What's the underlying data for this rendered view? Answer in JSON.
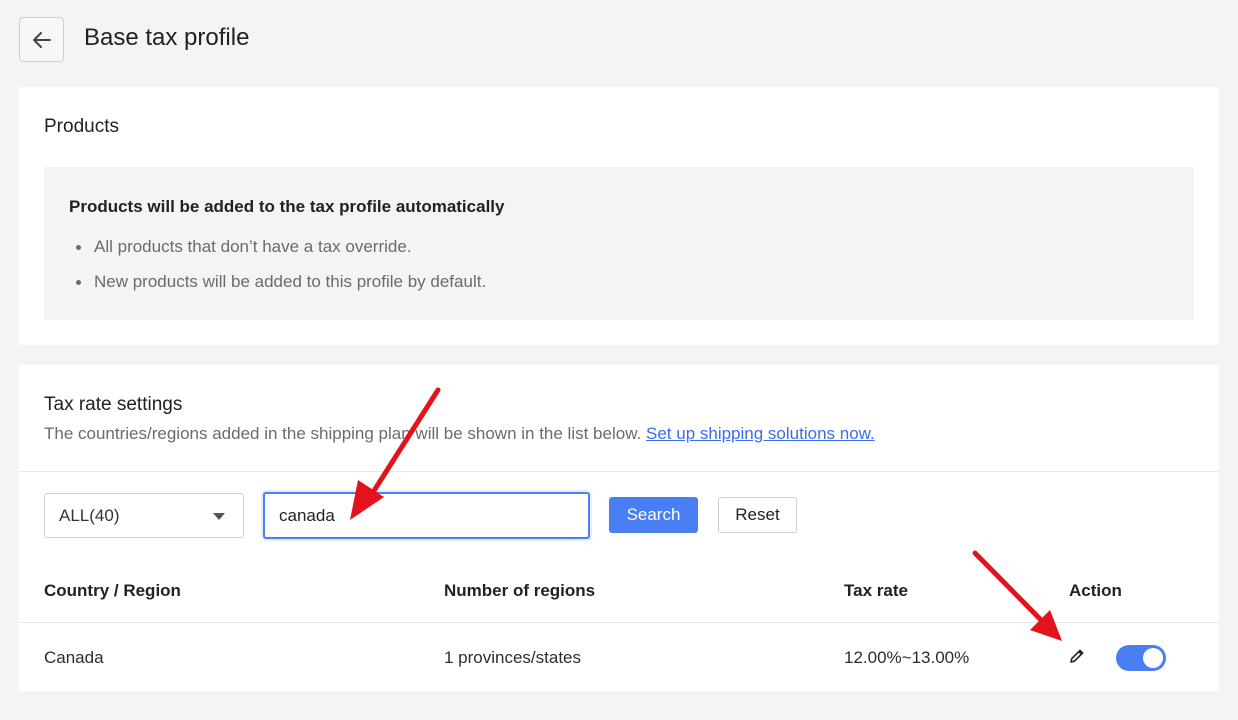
{
  "header": {
    "back_icon": "arrow-left-icon",
    "title": "Base tax profile"
  },
  "products": {
    "title": "Products",
    "info_heading": "Products will be added to the tax profile automatically",
    "bullets": [
      "All products that don’t have a tax override.",
      "New products will be added to this profile by default."
    ]
  },
  "tax_settings": {
    "title": "Tax rate settings",
    "description": "The countries/regions added in the shipping plan will be shown in the list below.",
    "link_text": "Set up shipping solutions now.",
    "filter": {
      "selected": "ALL(40)",
      "search_value": "canada",
      "search_label": "Search",
      "reset_label": "Reset"
    },
    "table": {
      "headers": [
        "Country / Region",
        "Number of regions",
        "Tax rate",
        "Action"
      ],
      "rows": [
        {
          "country": "Canada",
          "regions": "1 provinces/states",
          "tax_rate": "12.00%~13.00%",
          "edit_icon": "pencil-icon",
          "enabled": true
        }
      ]
    }
  },
  "colors": {
    "primary": "#4a7ef3",
    "link": "#3a6cf0",
    "annotation_arrow": "#e3121c",
    "background": "#f4f4f4"
  }
}
